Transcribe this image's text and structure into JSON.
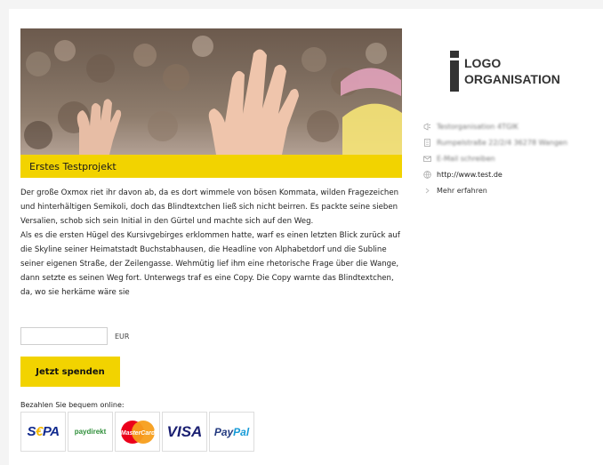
{
  "project": {
    "title": "Erstes Testprojekt",
    "paragraph1": "Der große Oxmox riet ihr davon ab, da es dort wimmele von bösen Kommata, wilden Fragezeichen und hinterhältigen Semikoli, doch das Blindtextchen ließ sich nicht beirren. Es packte seine sieben Versalien, schob sich sein Initial in den Gürtel und machte sich auf den Weg.",
    "paragraph2": "Als es die ersten Hügel des Kursivgebirges erklommen hatte, warf es einen letzten Blick zurück auf die Skyline seiner Heimatstadt Buchstabhausen, die Headline von Alphabetdorf und die Subline seiner eigenen Straße, der Zeilengasse. Wehmütig lief ihm eine rhetorische Frage über die Wange, dann setzte es seinen Weg fort. Unterwegs traf es eine Copy. Die Copy warnte das Blindtextchen, da, wo sie herkäme wäre sie"
  },
  "donation": {
    "amount_value": "",
    "currency": "EUR",
    "button_label": "Jetzt spenden",
    "pay_label": "Bezahlen Sie bequem online:",
    "methods": {
      "sepa": "SEPA",
      "paydirekt": "paydirekt",
      "mastercard": "MasterCard",
      "visa": "VISA",
      "paypal_pay": "Pay",
      "paypal_pal": "Pal"
    }
  },
  "sidebar": {
    "logo_line1": "LOGO",
    "logo_line2": "ORGANISATION",
    "org_name": "Testorganisation 4TGIK",
    "address": "Rumpelstraße 22/2/4 36278 Wangen",
    "email": "E-Mail schreiben",
    "website": "http://www.test.de",
    "more_link": "Mehr erfahren"
  },
  "colors": {
    "accent": "#f2d300",
    "background": "#f4f4f4"
  },
  "icons": {
    "org": "megaphone-icon",
    "address": "building-icon",
    "email": "envelope-icon",
    "website": "globe-icon",
    "more": "chevron-right-icon"
  }
}
